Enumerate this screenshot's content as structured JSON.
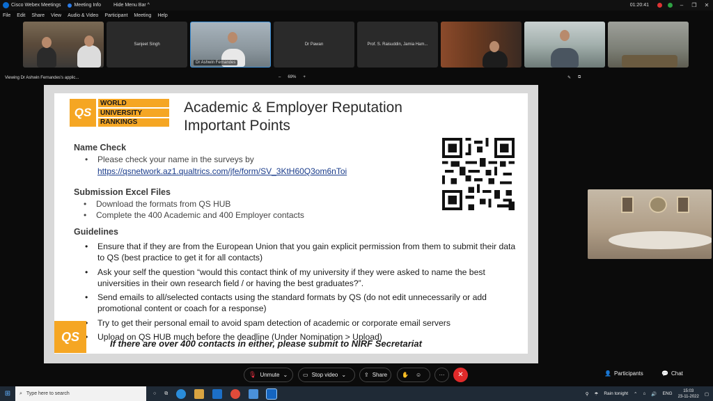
{
  "titlebar": {
    "app_title": "Cisco Webex Meetings",
    "meeting_info": "Meeting Info",
    "hide_menu": "Hide Menu Bar",
    "hide_menu_arrow": "^",
    "elapsed": "01:20:41",
    "minimize": "–",
    "restore": "❐",
    "close": "✕"
  },
  "menu": [
    "File",
    "Edit",
    "Share",
    "View",
    "Audio & Video",
    "Participant",
    "Meeting",
    "Help"
  ],
  "participants": [
    {
      "name": ""
    },
    {
      "name": "Sanjeet Singh"
    },
    {
      "name": "Dr Ashwin Fernandes"
    },
    {
      "name": "Dr Pawan"
    },
    {
      "name": "Prof. S. Raisuddin, Jamia Ham..."
    },
    {
      "name": ""
    },
    {
      "name": ""
    },
    {
      "name": ""
    }
  ],
  "share_bar": {
    "viewing": "Viewing Dr Ashwin Fernandes's applic...",
    "zoom_out": "–",
    "zoom": "69%",
    "zoom_in": "+"
  },
  "slide": {
    "logo_words": [
      "WORLD",
      "UNIVERSITY",
      "RANKINGS"
    ],
    "logo_mark": "QS",
    "title_line1": "Academic & Employer Reputation",
    "title_line2": "Important Points",
    "name_check": {
      "heading": "Name Check",
      "bullet": "Please check your name in the surveys by",
      "link": "https://qsnetwork.az1.qualtrics.com/jfe/form/SV_3KtH60Q3om6nToi"
    },
    "submission": {
      "heading": "Submission Excel Files",
      "bullets": [
        "Download the formats from QS HUB",
        "Complete the 400 Academic and 400 Employer contacts"
      ]
    },
    "guidelines": {
      "heading": "Guidelines",
      "bullets": [
        "Ensure that if they are from the European Union that you gain explicit permission from them to submit their data to QS (best practice to get it for all contacts)",
        "Ask your self the question “would this contact think of my university if they were asked to name the best universities in their own research field / or having the best graduates?”.",
        "Send emails to all/selected contacts using the standard formats by QS (do not edit unnecessarily or add promotional content or coach for a response)",
        "Try to get their personal email to avoid spam detection of academic or corporate email servers",
        "Upload on QS HUB much before the deadline (Under Nomination > Upload)"
      ]
    },
    "footer_note": "If there are over 400 contacts in either, please submit to NIRF Secretariat"
  },
  "controls": {
    "unmute": "Unmute",
    "stop_video": "Stop video",
    "share": "Share",
    "more": "···",
    "end": "✕",
    "participants": "Participants",
    "chat": "Chat"
  },
  "taskbar": {
    "search_placeholder": "Type here to search",
    "weather": "Rain tonight",
    "lang": "ENG",
    "time": "15:03",
    "date": "23-11-2022"
  },
  "colors": {
    "qs_orange": "#f5a623",
    "end_red": "#e02a2a",
    "link_blue": "#1a3c8b"
  }
}
